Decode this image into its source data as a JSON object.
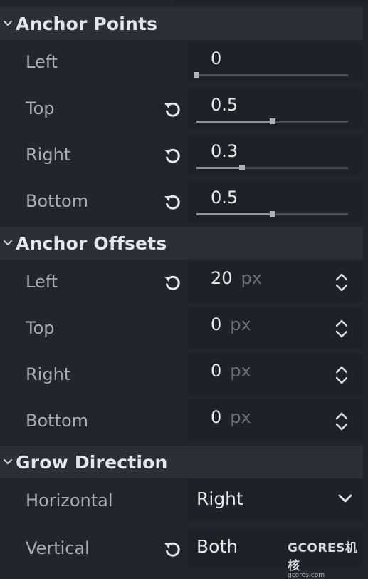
{
  "sections": {
    "anchor_points": {
      "title": "Anchor Points",
      "rows": [
        {
          "label": "Left",
          "value": "0",
          "slider": 0.0,
          "has_reset": false
        },
        {
          "label": "Top",
          "value": "0.5",
          "slider": 0.5,
          "has_reset": true
        },
        {
          "label": "Right",
          "value": "0.3",
          "slider": 0.3,
          "has_reset": true
        },
        {
          "label": "Bottom",
          "value": "0.5",
          "slider": 0.5,
          "has_reset": true
        }
      ]
    },
    "anchor_offsets": {
      "title": "Anchor Offsets",
      "rows": [
        {
          "label": "Left",
          "value": "20",
          "unit": "px",
          "has_reset": true
        },
        {
          "label": "Top",
          "value": "0",
          "unit": "px",
          "has_reset": false
        },
        {
          "label": "Right",
          "value": "0",
          "unit": "px",
          "has_reset": false
        },
        {
          "label": "Bottom",
          "value": "0",
          "unit": "px",
          "has_reset": false
        }
      ]
    },
    "grow_direction": {
      "title": "Grow Direction",
      "rows": [
        {
          "label": "Horizontal",
          "value": "Right",
          "has_reset": false
        },
        {
          "label": "Vertical",
          "value": "Both",
          "has_reset": true
        }
      ]
    }
  },
  "watermark": {
    "main": "GCORES机核",
    "sub": "gcores.com"
  },
  "icons": {
    "reset": "reset-icon",
    "collapse": "chevron-down-icon",
    "spin": "up-down-arrows-icon",
    "dropdown": "chevron-down-icon"
  },
  "colors": {
    "background": "#22252c",
    "header": "#2a2e36",
    "field": "#1e2128",
    "label": "#a9adb3",
    "value": "#e6e8eb"
  }
}
